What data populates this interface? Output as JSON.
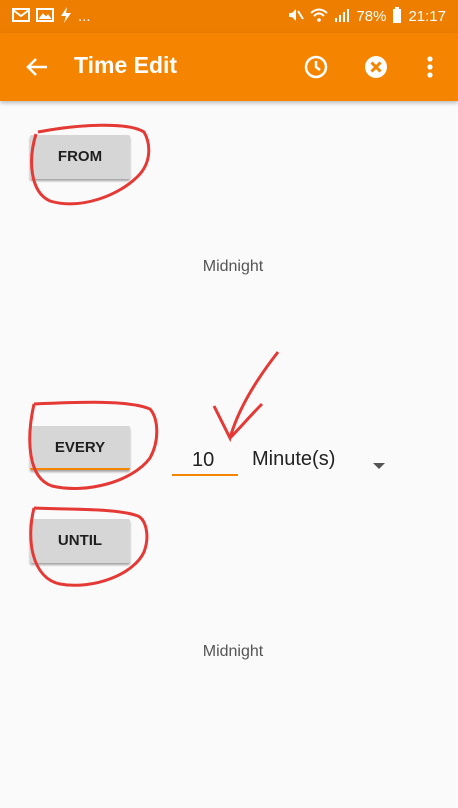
{
  "status_bar": {
    "left_icons": [
      "mail-icon",
      "image-icon",
      "flash-icon"
    ],
    "left_more": "...",
    "battery": "78%",
    "time": "21:17"
  },
  "appbar": {
    "title": "Time Edit"
  },
  "from": {
    "button_label": "FROM",
    "time": "Midnight"
  },
  "every": {
    "button_label": "EVERY",
    "value": "10",
    "unit": "Minute(s)"
  },
  "until": {
    "button_label": "UNTIL",
    "time": "Midnight"
  },
  "colors": {
    "accent": "#f58400",
    "annotation": "#e53935"
  }
}
